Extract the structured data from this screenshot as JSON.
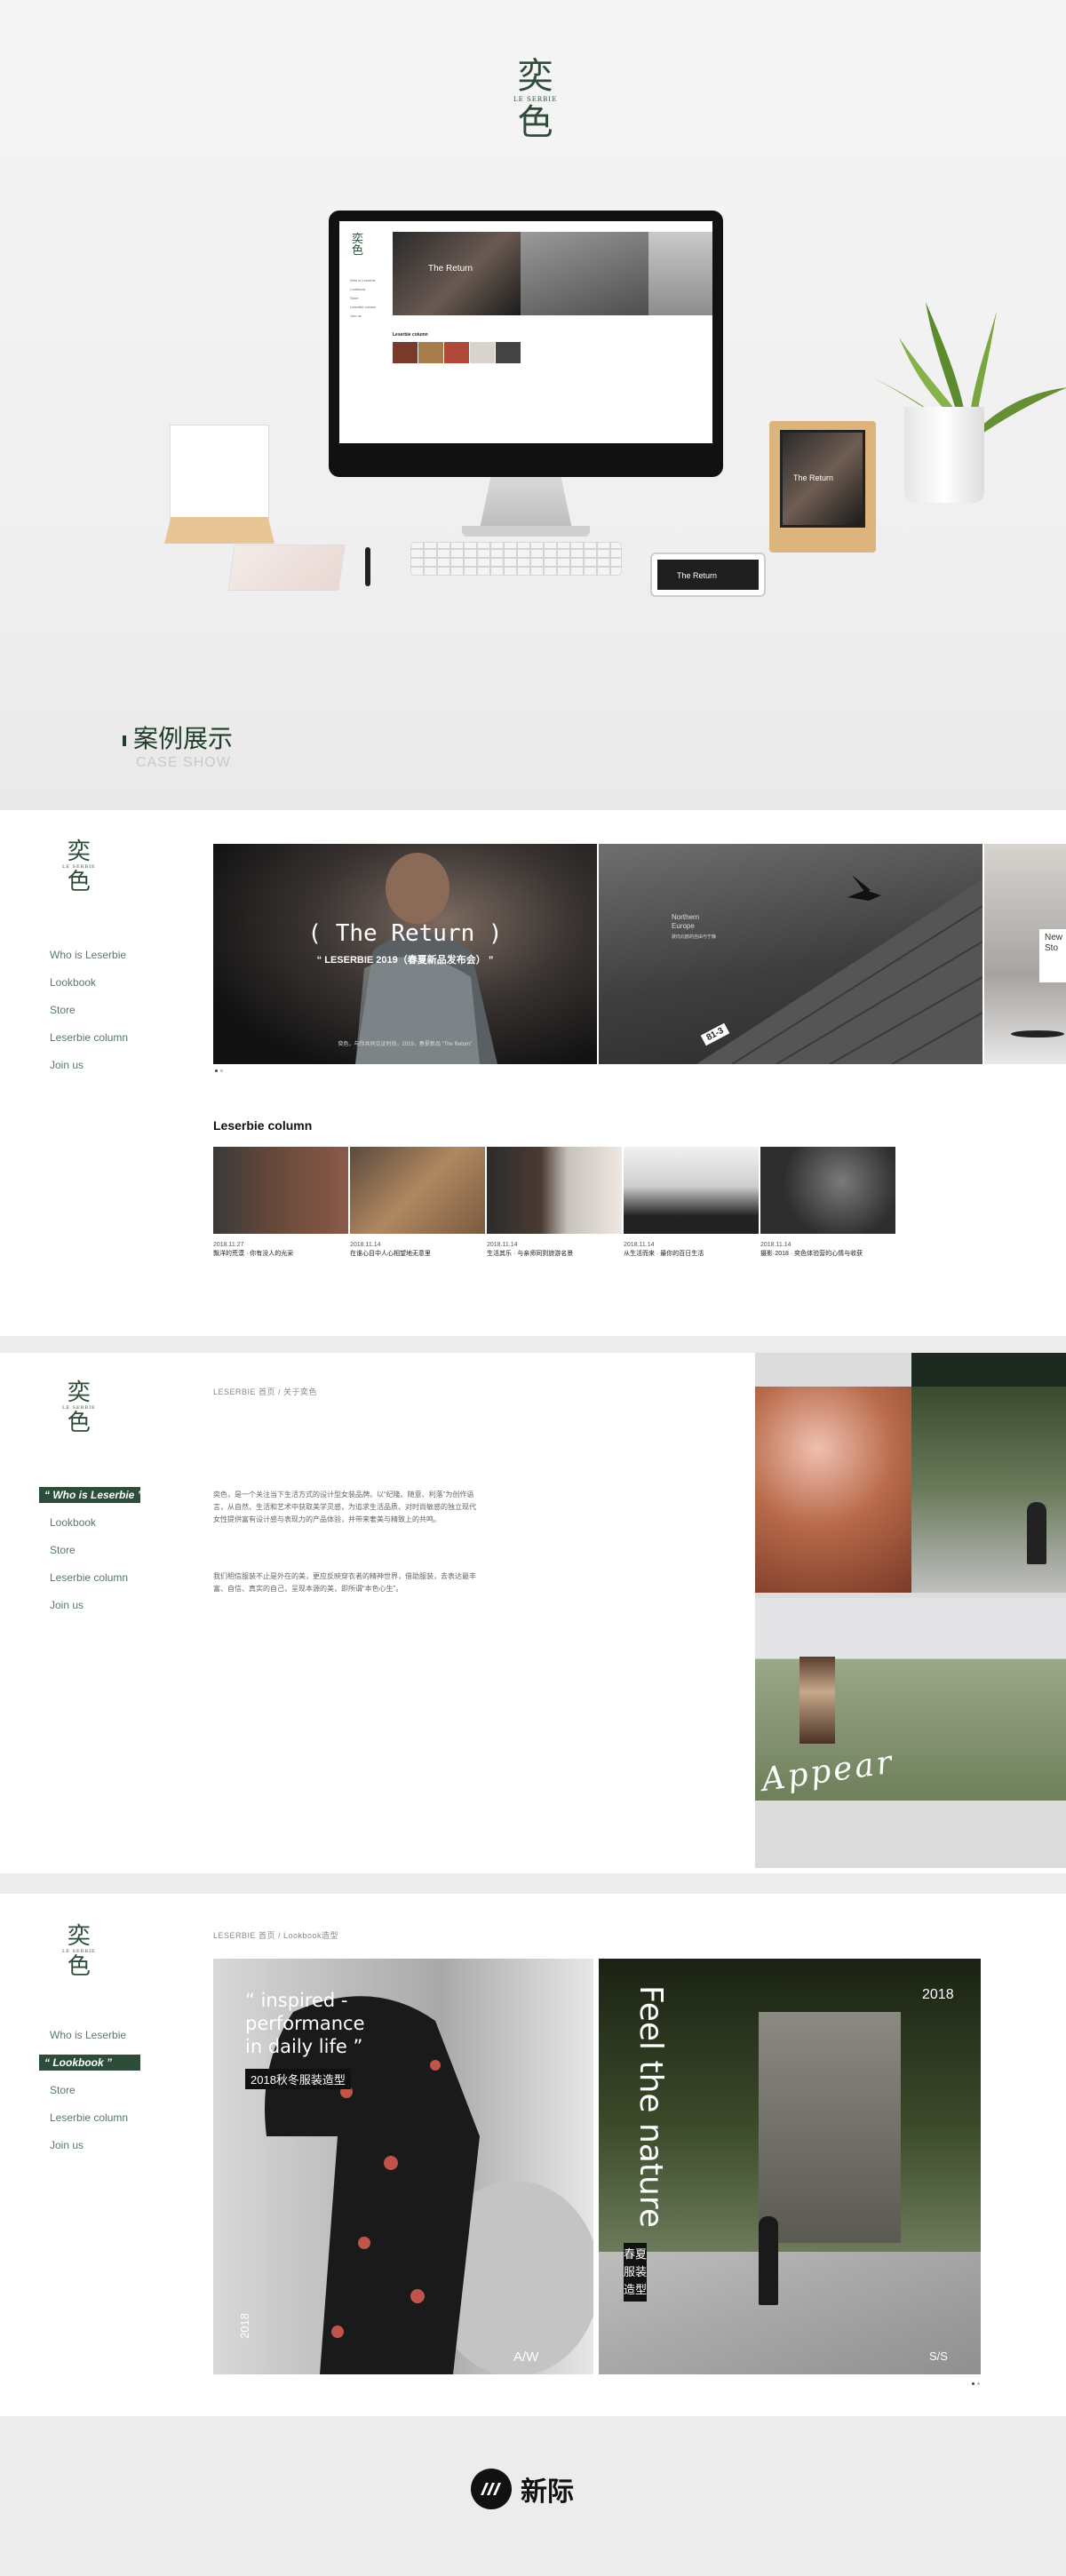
{
  "hero": {
    "logo_top": "奕",
    "logo_sub": "LE SERBIE",
    "logo_bottom": "色",
    "monitor": {
      "logo_top": "奕",
      "logo_bottom": "色",
      "nav": [
        "Who is Leserbie",
        "Lookbook",
        "Store",
        "Leserbie column",
        "Join us"
      ],
      "banner_title": "The Return",
      "column_title": "Leserbie column"
    },
    "frame_text": "The Return",
    "tablet_text": "The Return",
    "case_title": "案例展示",
    "case_sub": "CASE SHOW"
  },
  "nav_items": [
    "Who is Leserbie",
    "Lookbook",
    "Store",
    "Leserbie column",
    "Join us"
  ],
  "panel1": {
    "logo_top": "奕",
    "logo_sub": "LE SERBIE",
    "logo_bottom": "色",
    "banner": {
      "title": "( The Return )",
      "subtitle": "“ LESERBIE 2019（春夏新品发布会） ”",
      "small": "奕色，与你共同见证时尚，2019，春夏新品 “The Return”",
      "northern_line1": "Northern",
      "northern_line2": "Europe",
      "northern_sub": "驶向北欧的自由与宁静",
      "plate": "81-3",
      "right_line1": "New",
      "right_line2": "Sto"
    },
    "column_title": "Leserbie column",
    "column_items": [
      {
        "date": "2018.11.27",
        "caption": "飘洋的荒漠 · 你有没人的光采"
      },
      {
        "date": "2018.11.14",
        "caption": "在谁心目中人心相望地无意里"
      },
      {
        "date": "2018.11.14",
        "caption": "生活其乐 · 与亲师同到旅游名景"
      },
      {
        "date": "2018.11.14",
        "caption": "从生活而来 · 最你的百日生活"
      },
      {
        "date": "2018.11.14",
        "caption": "摄影·2018 · 奕色体验营的心情与收获"
      }
    ]
  },
  "panel2": {
    "logo_top": "奕",
    "logo_sub": "LE SERBIE",
    "logo_bottom": "色",
    "active_nav": "“ Who is Leserbie ”",
    "breadcrumb": "LESERBIE 首页 / 关于奕色",
    "para1": "奕色，是一个关注当下生活方式的设计型女装品牌。以“纪隆、随意、利落”为创作语言，从自然、生活和艺术中获取美学灵感，为追求生活品质、对时尚敏感的独立现代女性提供富有设计感与表现力的产品体验，并带来奢美与精致上的共鸣。",
    "para2": "我们相信服装不止是外在的美，更应反映穿衣者的精神世界，借助服装，去表达最丰富、自信、真实的自己，呈现本源的美，即所谓“本色心生”。",
    "script_text": "Appear"
  },
  "panel3": {
    "logo_top": "奕",
    "logo_sub": "LE SERBIE",
    "logo_bottom": "色",
    "active_nav": "“ Lookbook ”",
    "breadcrumb": "LESERBIE 首页 / Lookbook造型",
    "quote_line1": "“ inspired -",
    "quote_line2": "performance",
    "quote_line3": "in daily life ”",
    "season_tag": "2018秋冬服装造型",
    "year_left": "2018",
    "aw": "A/W",
    "feel": "Feel the nature",
    "year_right": "2018",
    "ss_tag": "春夏服装造型",
    "ss": "S/S"
  },
  "footer": {
    "brand": "新际"
  },
  "colors": {
    "brand_green": "#2d4d3a",
    "page_bg": "#ececec"
  }
}
